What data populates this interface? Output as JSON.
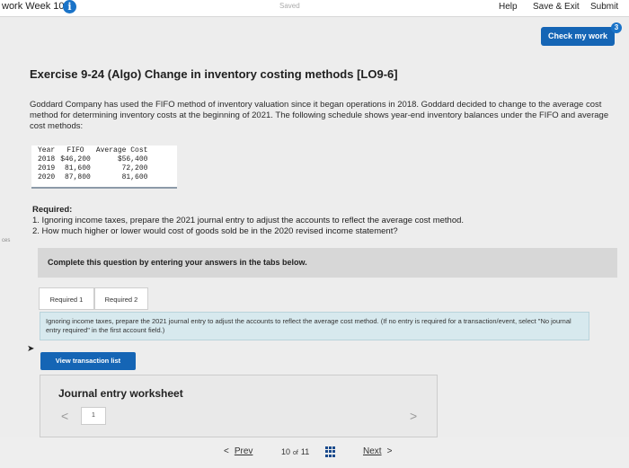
{
  "topbar": {
    "title": "work Week 10",
    "info_icon": "i",
    "saved": "Saved",
    "help": "Help",
    "save_exit": "Save & Exit",
    "submit": "Submit"
  },
  "check": {
    "label": "Check my work",
    "badge": "3"
  },
  "exercise": {
    "title": "Exercise 9-24 (Algo) Change in inventory costing methods [LO9-6]",
    "intro": "Goddard Company has used the FIFO method of inventory valuation since it began operations in 2018. Goddard decided to change to the average cost method for determining inventory costs at the beginning of 2021. The following schedule shows year-end inventory balances under the FIFO and average cost methods:"
  },
  "table": {
    "headers": [
      "Year",
      "FIFO",
      "Average Cost"
    ],
    "rows": [
      [
        "2018",
        "$46,200",
        "$56,400"
      ],
      [
        "2019",
        "81,600",
        "72,200"
      ],
      [
        "2020",
        "87,800",
        "81,600"
      ]
    ]
  },
  "required": {
    "heading": "Required:",
    "items": [
      "1. Ignoring income taxes, prepare the 2021 journal entry to adjust the accounts to reflect the average cost method.",
      "2. How much higher or lower would cost of goods sold be in the 2020 revised income statement?"
    ]
  },
  "side_label": "ces",
  "panel": {
    "text": "Complete this question by entering your answers in the tabs below."
  },
  "tabs": [
    "Required 1",
    "Required 2"
  ],
  "instruction": "Ignoring income taxes, prepare the 2021 journal entry to adjust the accounts to reflect the average cost method. (If no entry is required for a transaction/event, select \"No journal entry required\" in the first account field.)",
  "view_button": "View transaction list",
  "worksheet": {
    "title": "Journal entry worksheet",
    "prev_arrow": "<",
    "page": "1",
    "next_arrow": ">"
  },
  "footer": {
    "prev_arrow": "<",
    "prev": "Prev",
    "page_current": "10",
    "page_of": "of",
    "page_total": "11",
    "next": "Next",
    "next_arrow": ">"
  }
}
